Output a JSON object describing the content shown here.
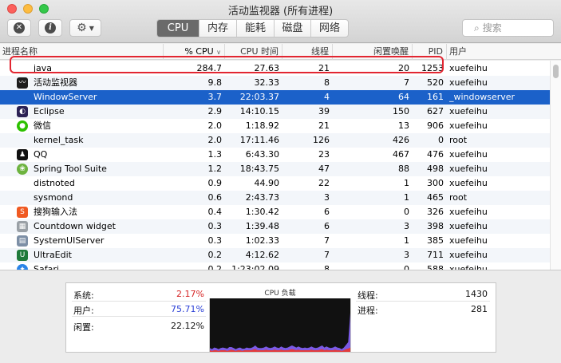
{
  "window": {
    "title": "活动监视器 (所有进程)"
  },
  "toolbar": {
    "stop_icon": "x-circle-icon",
    "info_icon": "info-circle-icon",
    "gear_icon": "gear-icon",
    "tabs": [
      {
        "label": "CPU",
        "active": true
      },
      {
        "label": "内存",
        "active": false
      },
      {
        "label": "能耗",
        "active": false
      },
      {
        "label": "磁盘",
        "active": false
      },
      {
        "label": "网络",
        "active": false
      }
    ],
    "search_placeholder": "搜索"
  },
  "table": {
    "columns": [
      "进程名称",
      "% CPU",
      "CPU 时间",
      "线程",
      "闲置唤醒",
      "PID",
      "用户"
    ],
    "sorted_column": "% CPU",
    "selected_row": 2,
    "rows": [
      {
        "name": "java",
        "cpu": "284.7",
        "time": "27.63",
        "threads": "21",
        "wakeups": "20",
        "pid": "1253",
        "user": "xuefeihu",
        "icon": "none",
        "color": ""
      },
      {
        "name": "活动监视器",
        "cpu": "9.8",
        "time": "32.33",
        "threads": "8",
        "wakeups": "7",
        "pid": "520",
        "user": "xuefeihu",
        "icon": "activity-monitor-icon",
        "color": "#1d1d1d"
      },
      {
        "name": "WindowServer",
        "cpu": "3.7",
        "time": "22:03.37",
        "threads": "4",
        "wakeups": "64",
        "pid": "161",
        "user": "_windowserver",
        "icon": "none",
        "color": ""
      },
      {
        "name": "Eclipse",
        "cpu": "2.9",
        "time": "14:10.15",
        "threads": "39",
        "wakeups": "150",
        "pid": "627",
        "user": "xuefeihu",
        "icon": "eclipse-icon",
        "color": "#2c2255"
      },
      {
        "name": "微信",
        "cpu": "2.0",
        "time": "1:18.92",
        "threads": "21",
        "wakeups": "13",
        "pid": "906",
        "user": "xuefeihu",
        "icon": "wechat-icon",
        "color": "#2dc100"
      },
      {
        "name": "kernel_task",
        "cpu": "2.0",
        "time": "17:11.46",
        "threads": "126",
        "wakeups": "426",
        "pid": "0",
        "user": "root",
        "icon": "none",
        "color": ""
      },
      {
        "name": "QQ",
        "cpu": "1.3",
        "time": "6:43.30",
        "threads": "23",
        "wakeups": "467",
        "pid": "476",
        "user": "xuefeihu",
        "icon": "qq-penguin-icon",
        "color": "#111111"
      },
      {
        "name": "Spring Tool Suite",
        "cpu": "1.2",
        "time": "18:43.75",
        "threads": "47",
        "wakeups": "88",
        "pid": "498",
        "user": "xuefeihu",
        "icon": "spring-leaf-icon",
        "color": "#6db33f"
      },
      {
        "name": "distnoted",
        "cpu": "0.9",
        "time": "44.90",
        "threads": "22",
        "wakeups": "1",
        "pid": "300",
        "user": "xuefeihu",
        "icon": "none",
        "color": ""
      },
      {
        "name": "sysmond",
        "cpu": "0.6",
        "time": "2:43.73",
        "threads": "3",
        "wakeups": "1",
        "pid": "465",
        "user": "root",
        "icon": "none",
        "color": ""
      },
      {
        "name": "搜狗输入法",
        "cpu": "0.4",
        "time": "1:30.42",
        "threads": "6",
        "wakeups": "0",
        "pid": "326",
        "user": "xuefeihu",
        "icon": "sogou-s-icon",
        "color": "#f05a22"
      },
      {
        "name": "Countdown widget",
        "cpu": "0.3",
        "time": "1:39.48",
        "threads": "6",
        "wakeups": "3",
        "pid": "398",
        "user": "xuefeihu",
        "icon": "calendar-icon",
        "color": "#9aa0a6"
      },
      {
        "name": "SystemUIServer",
        "cpu": "0.3",
        "time": "1:02.33",
        "threads": "7",
        "wakeups": "1",
        "pid": "385",
        "user": "xuefeihu",
        "icon": "document-icon",
        "color": "#7d8fa6"
      },
      {
        "name": "UltraEdit",
        "cpu": "0.2",
        "time": "4:12.62",
        "threads": "7",
        "wakeups": "3",
        "pid": "711",
        "user": "xuefeihu",
        "icon": "ultraedit-icon",
        "color": "#1f7a3a"
      },
      {
        "name": "Safari",
        "cpu": "0.2",
        "time": "1:23:02.09",
        "threads": "8",
        "wakeups": "0",
        "pid": "588",
        "user": "xuefeihu",
        "icon": "compass-icon",
        "color": "#2a84e8"
      }
    ]
  },
  "summary": {
    "system_label": "系统:",
    "system_value": "2.17%",
    "system_color": "#d62525",
    "user_label": "用户:",
    "user_value": "75.71%",
    "user_color": "#2a3fd6",
    "idle_label": "闲置:",
    "idle_value": "22.12%",
    "chart_title": "CPU 负载",
    "threads_label": "线程:",
    "threads_value": "1430",
    "processes_label": "进程:",
    "processes_value": "281"
  },
  "cpu_load": {
    "user_pct": [
      4,
      3,
      5,
      4,
      3,
      4,
      5,
      4,
      4,
      6,
      5,
      4,
      3,
      4,
      5,
      4,
      3,
      5,
      4,
      4,
      5,
      7,
      5,
      4,
      4,
      5,
      6,
      5,
      4,
      5,
      6,
      5,
      4,
      6,
      5,
      4,
      5,
      6,
      7,
      6,
      5,
      6,
      5,
      4,
      5,
      4,
      5,
      6,
      5,
      4,
      5,
      6,
      7,
      5,
      6,
      5,
      4,
      5,
      6,
      5,
      4,
      3,
      5,
      8,
      12,
      65
    ],
    "system_pct": [
      3,
      2,
      3,
      3,
      2,
      3,
      3,
      3,
      2,
      3,
      4,
      3,
      2,
      3,
      3,
      2,
      3,
      3,
      3,
      3,
      4,
      5,
      3,
      3,
      3,
      3,
      4,
      3,
      3,
      3,
      4,
      3,
      3,
      4,
      3,
      3,
      3,
      4,
      5,
      4,
      3,
      4,
      3,
      3,
      3,
      3,
      3,
      4,
      3,
      3,
      3,
      4,
      5,
      3,
      4,
      3,
      3,
      3,
      4,
      3,
      3,
      2,
      3,
      5,
      6,
      8
    ]
  }
}
